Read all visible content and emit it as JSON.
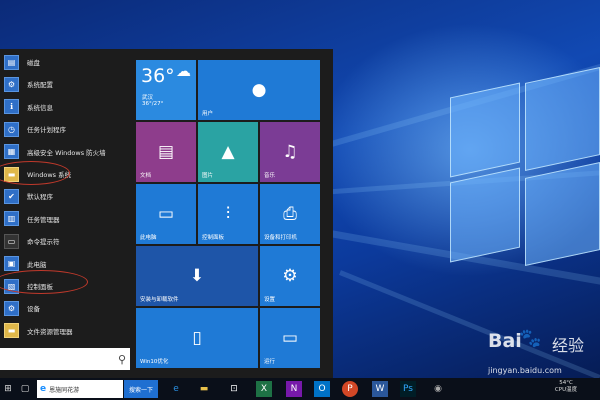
{
  "start_menu": {
    "apps": [
      {
        "label": "磁盘",
        "icon": "disk-icon",
        "glyph": "▤"
      },
      {
        "label": "系统配置",
        "icon": "system-config-icon",
        "glyph": "⚙"
      },
      {
        "label": "系统信息",
        "icon": "system-info-icon",
        "glyph": "ℹ"
      },
      {
        "label": "任务计划程序",
        "icon": "task-scheduler-icon",
        "glyph": "◷"
      },
      {
        "label": "高级安全 Windows 防火墙",
        "icon": "firewall-icon",
        "glyph": "▦"
      },
      {
        "label": "Windows 系统",
        "icon": "folder-icon",
        "glyph": "▬"
      },
      {
        "label": "默认程序",
        "icon": "default-programs-icon",
        "glyph": "✔"
      },
      {
        "label": "任务管理器",
        "icon": "task-manager-icon",
        "glyph": "▥"
      },
      {
        "label": "命令提示符",
        "icon": "command-prompt-icon",
        "glyph": "▭"
      },
      {
        "label": "此电脑",
        "icon": "this-pc-icon",
        "glyph": "▣"
      },
      {
        "label": "控制面板",
        "icon": "control-panel-icon",
        "glyph": "▧"
      },
      {
        "label": "设备",
        "icon": "devices-icon",
        "glyph": "⚙"
      },
      {
        "label": "文件资源管理器",
        "icon": "file-explorer-icon",
        "glyph": "▬"
      }
    ],
    "search_icon": "search-icon",
    "tiles": {
      "weather": {
        "temp": "36°",
        "city": "武汉",
        "range": "36°/27°"
      },
      "user": {
        "label": "用户",
        "icon": "user-icon"
      },
      "docs": {
        "label": "文档",
        "icon": "document-icon"
      },
      "pics": {
        "label": "图片",
        "icon": "picture-icon"
      },
      "music": {
        "label": "音乐",
        "icon": "headphones-icon"
      },
      "this_pc": {
        "label": "此电脑",
        "icon": "monitor-icon"
      },
      "control": {
        "label": "控制面板",
        "icon": "sliders-icon"
      },
      "printers": {
        "label": "设备和打印机",
        "icon": "printer-icon"
      },
      "store": {
        "label": "安装与卸载软件",
        "icon": "store-icon"
      },
      "settings": {
        "label": "设置",
        "icon": "gear-icon"
      },
      "win10": {
        "label": "Win10优化",
        "icon": "optimize-icon"
      },
      "run": {
        "label": "运行",
        "icon": "run-icon"
      }
    }
  },
  "taskbar": {
    "search_text": "恩施同花游",
    "search_button": "搜索一下",
    "tray_line1": "54°C",
    "tray_line2": "CPU温度"
  },
  "watermark": {
    "logo": "Bai",
    "suffix": "经验",
    "url": "jingyan.baidu.com"
  },
  "colors": {
    "accent": "#1f7ad6",
    "start_bg": "#1c1c1c",
    "taskbar_bg": "#0a0f19",
    "highlight_circle": "#c0392b"
  }
}
